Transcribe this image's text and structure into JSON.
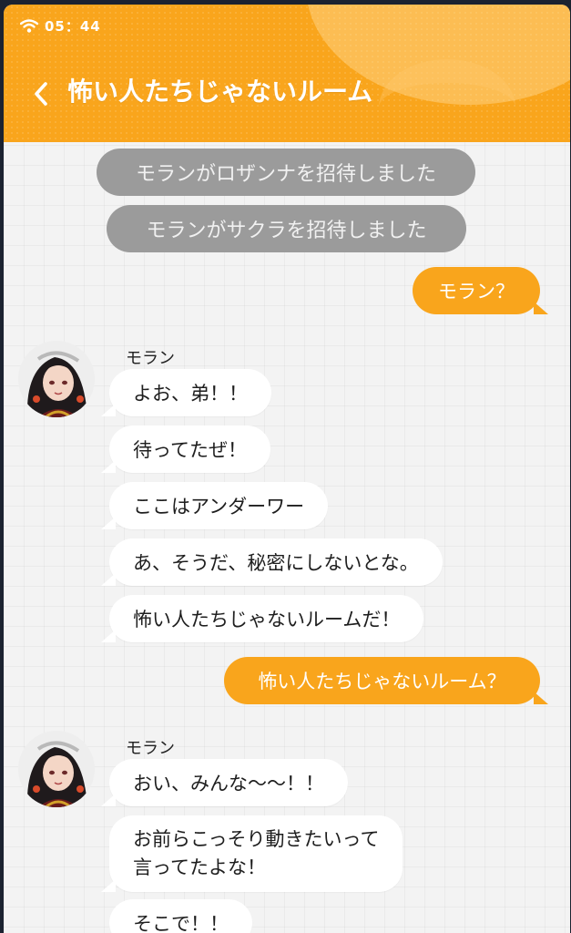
{
  "status_bar": {
    "time": "05：44",
    "wifi_icon": "wifi-icon"
  },
  "header": {
    "back_icon": "chevron-left-icon",
    "title": "怖い人たちじゃないルーム",
    "accent_color": "#f9a51c"
  },
  "messages": [
    {
      "type": "system",
      "text": "モランがロザンナを招待しました"
    },
    {
      "type": "system",
      "text": "モランがサクラを招待しました"
    },
    {
      "type": "outgoing",
      "text": "モラン？"
    },
    {
      "type": "incoming_group",
      "sender": "モラン",
      "lines": [
        "よお、弟！！",
        "待ってたぜ！",
        "ここはアンダーワー",
        "あ、そうだ、秘密にしないとな。",
        "怖い人たちじゃないルームだ！"
      ]
    },
    {
      "type": "outgoing",
      "text": "怖い人たちじゃないルーム？"
    },
    {
      "type": "incoming_group",
      "sender": "モラン",
      "lines": [
        "おい、みんな～～！！",
        "お前らこっそり動きたいって言ってたよな！",
        "そこで！！"
      ]
    }
  ],
  "multiline": {
    "first": "お前らこっそり動きたいって",
    "second": "言ってたよな！"
  }
}
